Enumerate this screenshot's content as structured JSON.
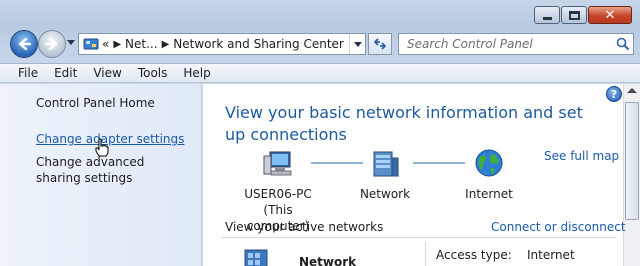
{
  "navigation": {
    "back_icon": "back-arrow-icon",
    "forward_icon": "forward-arrow-icon"
  },
  "address_bar": {
    "overflow": "«",
    "segments": [
      "Net...",
      "Network and Sharing Center"
    ],
    "icon": "control-panel-icon"
  },
  "search": {
    "placeholder": "Search Control Panel",
    "value": ""
  },
  "menu": [
    "File",
    "Edit",
    "View",
    "Tools",
    "Help"
  ],
  "left_pane": {
    "home": "Control Panel Home",
    "links": [
      "Change adapter settings",
      "Change advanced sharing settings"
    ]
  },
  "main": {
    "heading": "View your basic network information and set up connections",
    "see_full_map": "See full map",
    "nodes": [
      {
        "label": "USER06-PC",
        "sublabel": "(This computer)",
        "icon": "computer-icon"
      },
      {
        "label": "Network",
        "sublabel": "",
        "icon": "network-icon"
      },
      {
        "label": "Internet",
        "sublabel": "",
        "icon": "globe-icon"
      }
    ],
    "active_networks_label": "View your active networks",
    "connect_disconnect": "Connect or disconnect",
    "network_name": "Network",
    "access_type_label": "Access type:",
    "access_type_value": "Internet"
  },
  "colors": {
    "link": "#1a5aab",
    "heading": "#1e5aa0",
    "chrome": "#c6d6ea"
  }
}
